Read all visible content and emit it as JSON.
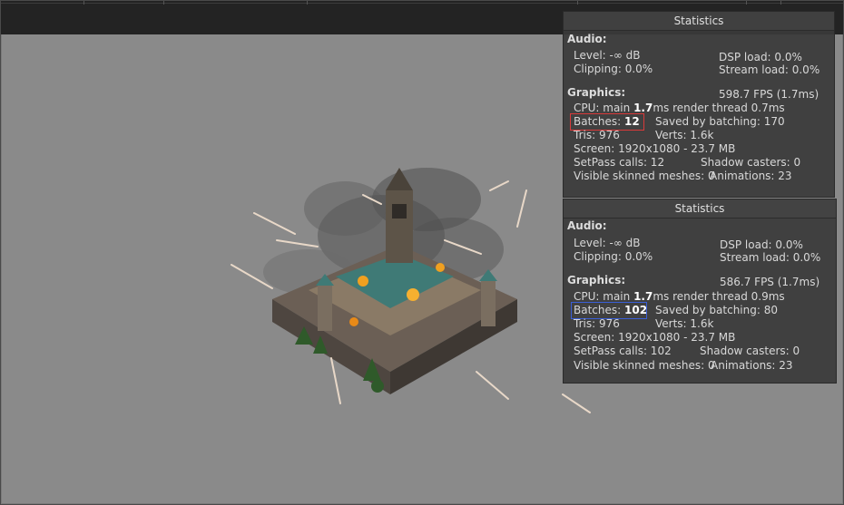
{
  "stats_top": {
    "title": "Statistics",
    "audio_header": "Audio:",
    "level": "Level: -∞ dB",
    "dsp": "DSP load: 0.0%",
    "clipping": "Clipping: 0.0%",
    "stream": "Stream load: 0.0%",
    "graphics_header": "Graphics:",
    "fps": "598.7 FPS (1.7ms)",
    "cpu_a": "CPU: main ",
    "cpu_b": "1.7",
    "cpu_c": "ms  render thread 0.7ms",
    "batches_label": "Batches: ",
    "batches_value": "12",
    "saved": "Saved by batching: 170",
    "tris": "Tris: 976",
    "verts": "Verts: 1.6k",
    "screen": "Screen: 1920x1080 - 23.7 MB",
    "setpass": "SetPass calls: 12",
    "shadow": "Shadow casters: 0",
    "skinned": "Visible skinned meshes: 0",
    "animations": "Animations: 23",
    "highlight_color": "#d93a3a"
  },
  "stats_bottom": {
    "title": "Statistics",
    "audio_header": "Audio:",
    "level": "Level: -∞ dB",
    "dsp": "DSP load: 0.0%",
    "clipping": "Clipping: 0.0%",
    "stream": "Stream load: 0.0%",
    "graphics_header": "Graphics:",
    "fps": "586.7 FPS (1.7ms)",
    "cpu_a": "CPU: main ",
    "cpu_b": "1.7",
    "cpu_c": "ms  render thread 0.9ms",
    "batches_label": "Batches: ",
    "batches_value": "102",
    "saved": "Saved by batching: 80",
    "tris": "Tris: 976",
    "verts": "Verts: 1.6k",
    "screen": "Screen: 1920x1080 - 23.7 MB",
    "setpass": "SetPass calls: 102",
    "shadow": "Shadow casters: 0",
    "skinned": "Visible skinned meshes: 0",
    "animations": "Animations: 23",
    "highlight_color": "#3a5fd6"
  }
}
